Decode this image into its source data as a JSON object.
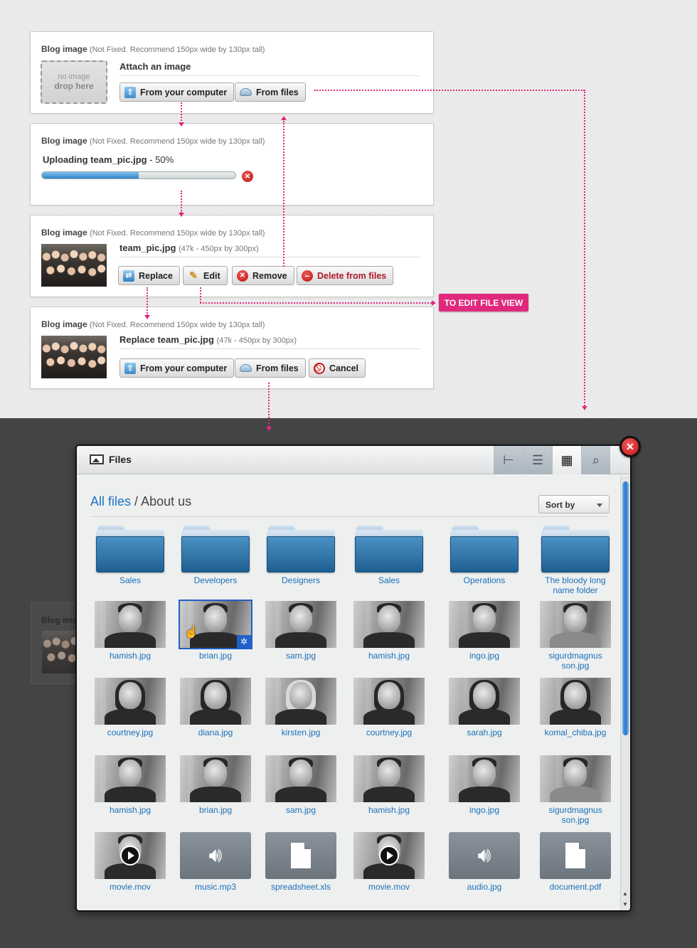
{
  "panels": {
    "title": "Blog image",
    "hint": "(Not Fixed. Recommend 150px wide by 130px tall)",
    "empty": {
      "drop_line1": "no image",
      "drop_line2": "drop here",
      "heading": "Attach an image",
      "btn_computer": "From your computer",
      "btn_files": "From files"
    },
    "uploading": {
      "label": "Uploading team_pic.jpg",
      "percent_text": "- 50%",
      "progress": 0.5
    },
    "attached": {
      "filename": "team_pic.jpg",
      "meta": "(47k - 450px by 300px)",
      "btn_replace": "Replace",
      "btn_edit": "Edit",
      "btn_remove": "Remove",
      "btn_delete": "Delete from files"
    },
    "replace": {
      "heading": "Replace team_pic.jpg",
      "meta": "(47k - 450px by 300px)",
      "btn_computer": "From your computer",
      "btn_files": "From files",
      "btn_cancel": "Cancel"
    }
  },
  "annotation": {
    "edit_badge": "TO EDIT FILE VIEW"
  },
  "ghost": {
    "title": "Blog ima"
  },
  "modal": {
    "title": "Files",
    "view_buttons": [
      "tree-view",
      "list-view",
      "grid-view",
      "search"
    ],
    "active_view": "grid-view",
    "breadcrumb_root": "All files",
    "breadcrumb_sep": "/",
    "breadcrumb_current": "About us",
    "sort_label": "Sort by",
    "folders": [
      "Sales",
      "Developers",
      "Designers",
      "Sales",
      "Operations",
      "The bloody long name folder"
    ],
    "rows": [
      [
        "hamish.jpg",
        "brian.jpg",
        "sam.jpg",
        "hamish.jpg",
        "ingo.jpg",
        "sigurdmagnus son.jpg"
      ],
      [
        "courtney.jpg",
        "diana.jpg",
        "kirsten.jpg",
        "courtney.jpg",
        "sarah.jpg",
        "komal_chiba.jpg"
      ],
      [
        "hamish.jpg",
        "brian.jpg",
        "sam.jpg",
        "hamish.jpg",
        "ingo.jpg",
        "sigurdmagnus son.jpg"
      ],
      [
        "movie.mov",
        "music.mp3",
        "spreadsheet.xls",
        "movie.mov",
        "audio.jpg",
        "document.pdf"
      ]
    ]
  },
  "colors": {
    "accent": "#e0297d",
    "link": "#1a6fb8",
    "danger": "#b0192a",
    "selection": "#2160c8"
  }
}
